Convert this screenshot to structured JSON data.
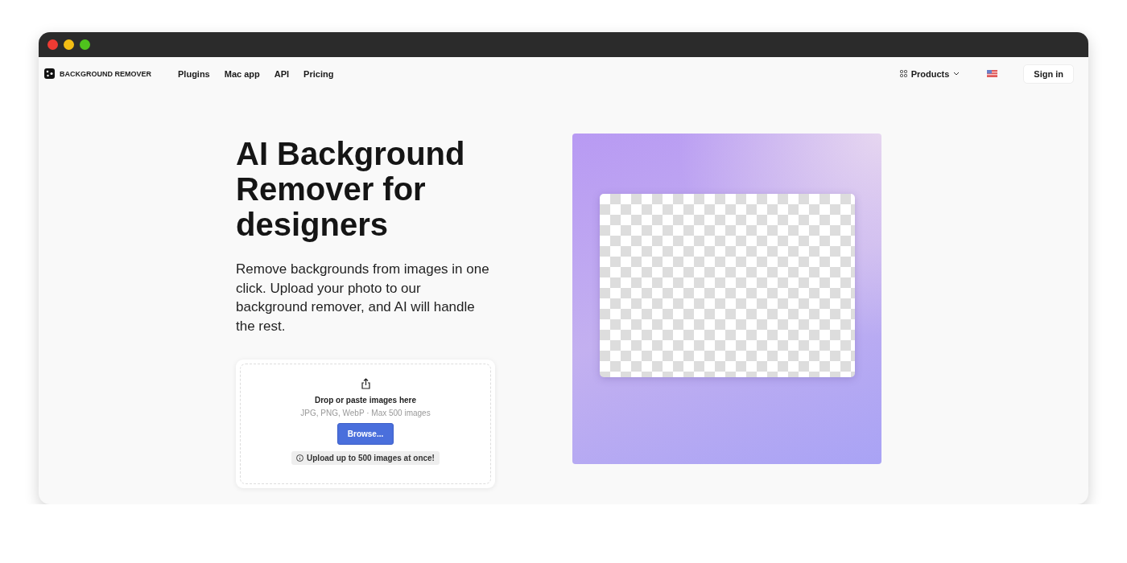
{
  "nav": {
    "brand": "BACKGROUND REMOVER",
    "links": [
      "Plugins",
      "Mac app",
      "API",
      "Pricing"
    ],
    "products": "Products",
    "sign_in": "Sign in"
  },
  "hero": {
    "title": "AI Background Remover for designers",
    "description": "Remove backgrounds from images in one click. Upload your photo to our background remover, and AI will handle the rest."
  },
  "upload": {
    "heading": "Drop or paste images here",
    "formats": "JPG, PNG, WebP · Max 500 images",
    "button": "Browse...",
    "note": "Upload up to 500 images at once!"
  }
}
